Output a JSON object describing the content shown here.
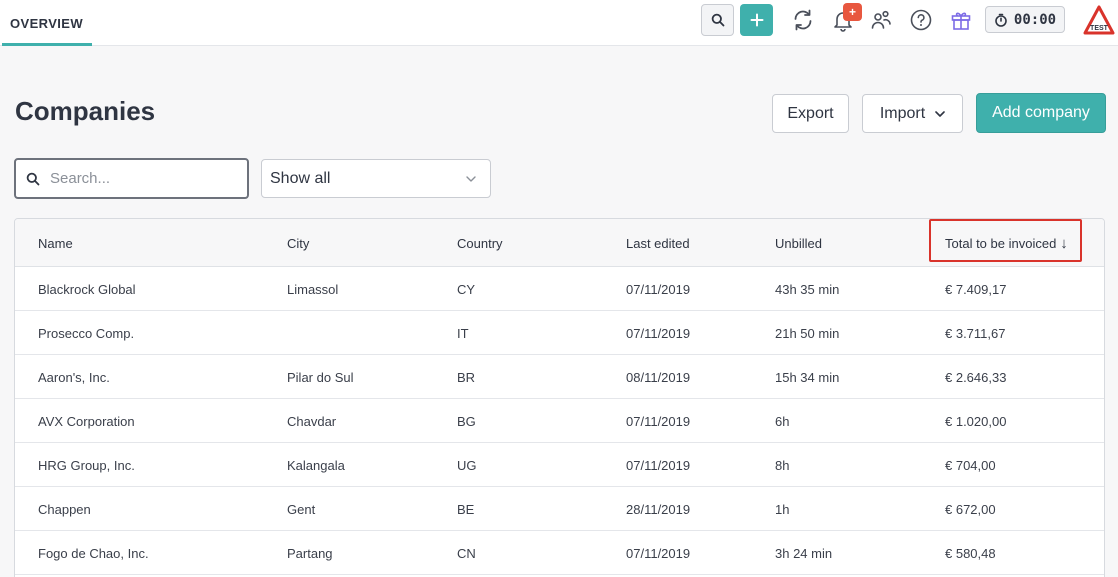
{
  "nav": {
    "tab_overview": "OVERVIEW"
  },
  "toolbar": {
    "notification_badge": "+",
    "timer_value": "00:00",
    "logo_text": "TEST"
  },
  "header": {
    "title": "Companies",
    "export_label": "Export",
    "import_label": "Import",
    "add_label": "Add company"
  },
  "filters": {
    "search_placeholder": "Search...",
    "show_selected": "Show all"
  },
  "table": {
    "columns": [
      "Name",
      "City",
      "Country",
      "Last edited",
      "Unbilled",
      "Total to be invoiced"
    ],
    "sort_indicator": "↓",
    "rows": [
      {
        "name": "Blackrock Global",
        "city": "Limassol",
        "country": "CY",
        "last_edited": "07/11/2019",
        "unbilled": "43h 35 min",
        "total": "€ 7.409,17"
      },
      {
        "name": "Prosecco Comp.",
        "city": "",
        "country": "IT",
        "last_edited": "07/11/2019",
        "unbilled": "21h 50 min",
        "total": "€ 3.711,67"
      },
      {
        "name": "Aaron's, Inc.",
        "city": "Pilar do Sul",
        "country": "BR",
        "last_edited": "08/11/2019",
        "unbilled": "15h 34 min",
        "total": "€ 2.646,33"
      },
      {
        "name": "AVX Corporation",
        "city": "Chavdar",
        "country": "BG",
        "last_edited": "07/11/2019",
        "unbilled": "6h",
        "total": "€ 1.020,00"
      },
      {
        "name": "HRG Group, Inc.",
        "city": "Kalangala",
        "country": "UG",
        "last_edited": "07/11/2019",
        "unbilled": "8h",
        "total": "€ 704,00"
      },
      {
        "name": "Chappen",
        "city": "Gent",
        "country": "BE",
        "last_edited": "28/11/2019",
        "unbilled": "1h",
        "total": "€ 672,00"
      },
      {
        "name": "Fogo de Chao, Inc.",
        "city": "Partang",
        "country": "CN",
        "last_edited": "07/11/2019",
        "unbilled": "3h 24 min",
        "total": "€ 580,48"
      }
    ]
  },
  "colors": {
    "accent": "#3fb0ac",
    "badge": "#e8573f",
    "highlight": "#d9332b"
  }
}
